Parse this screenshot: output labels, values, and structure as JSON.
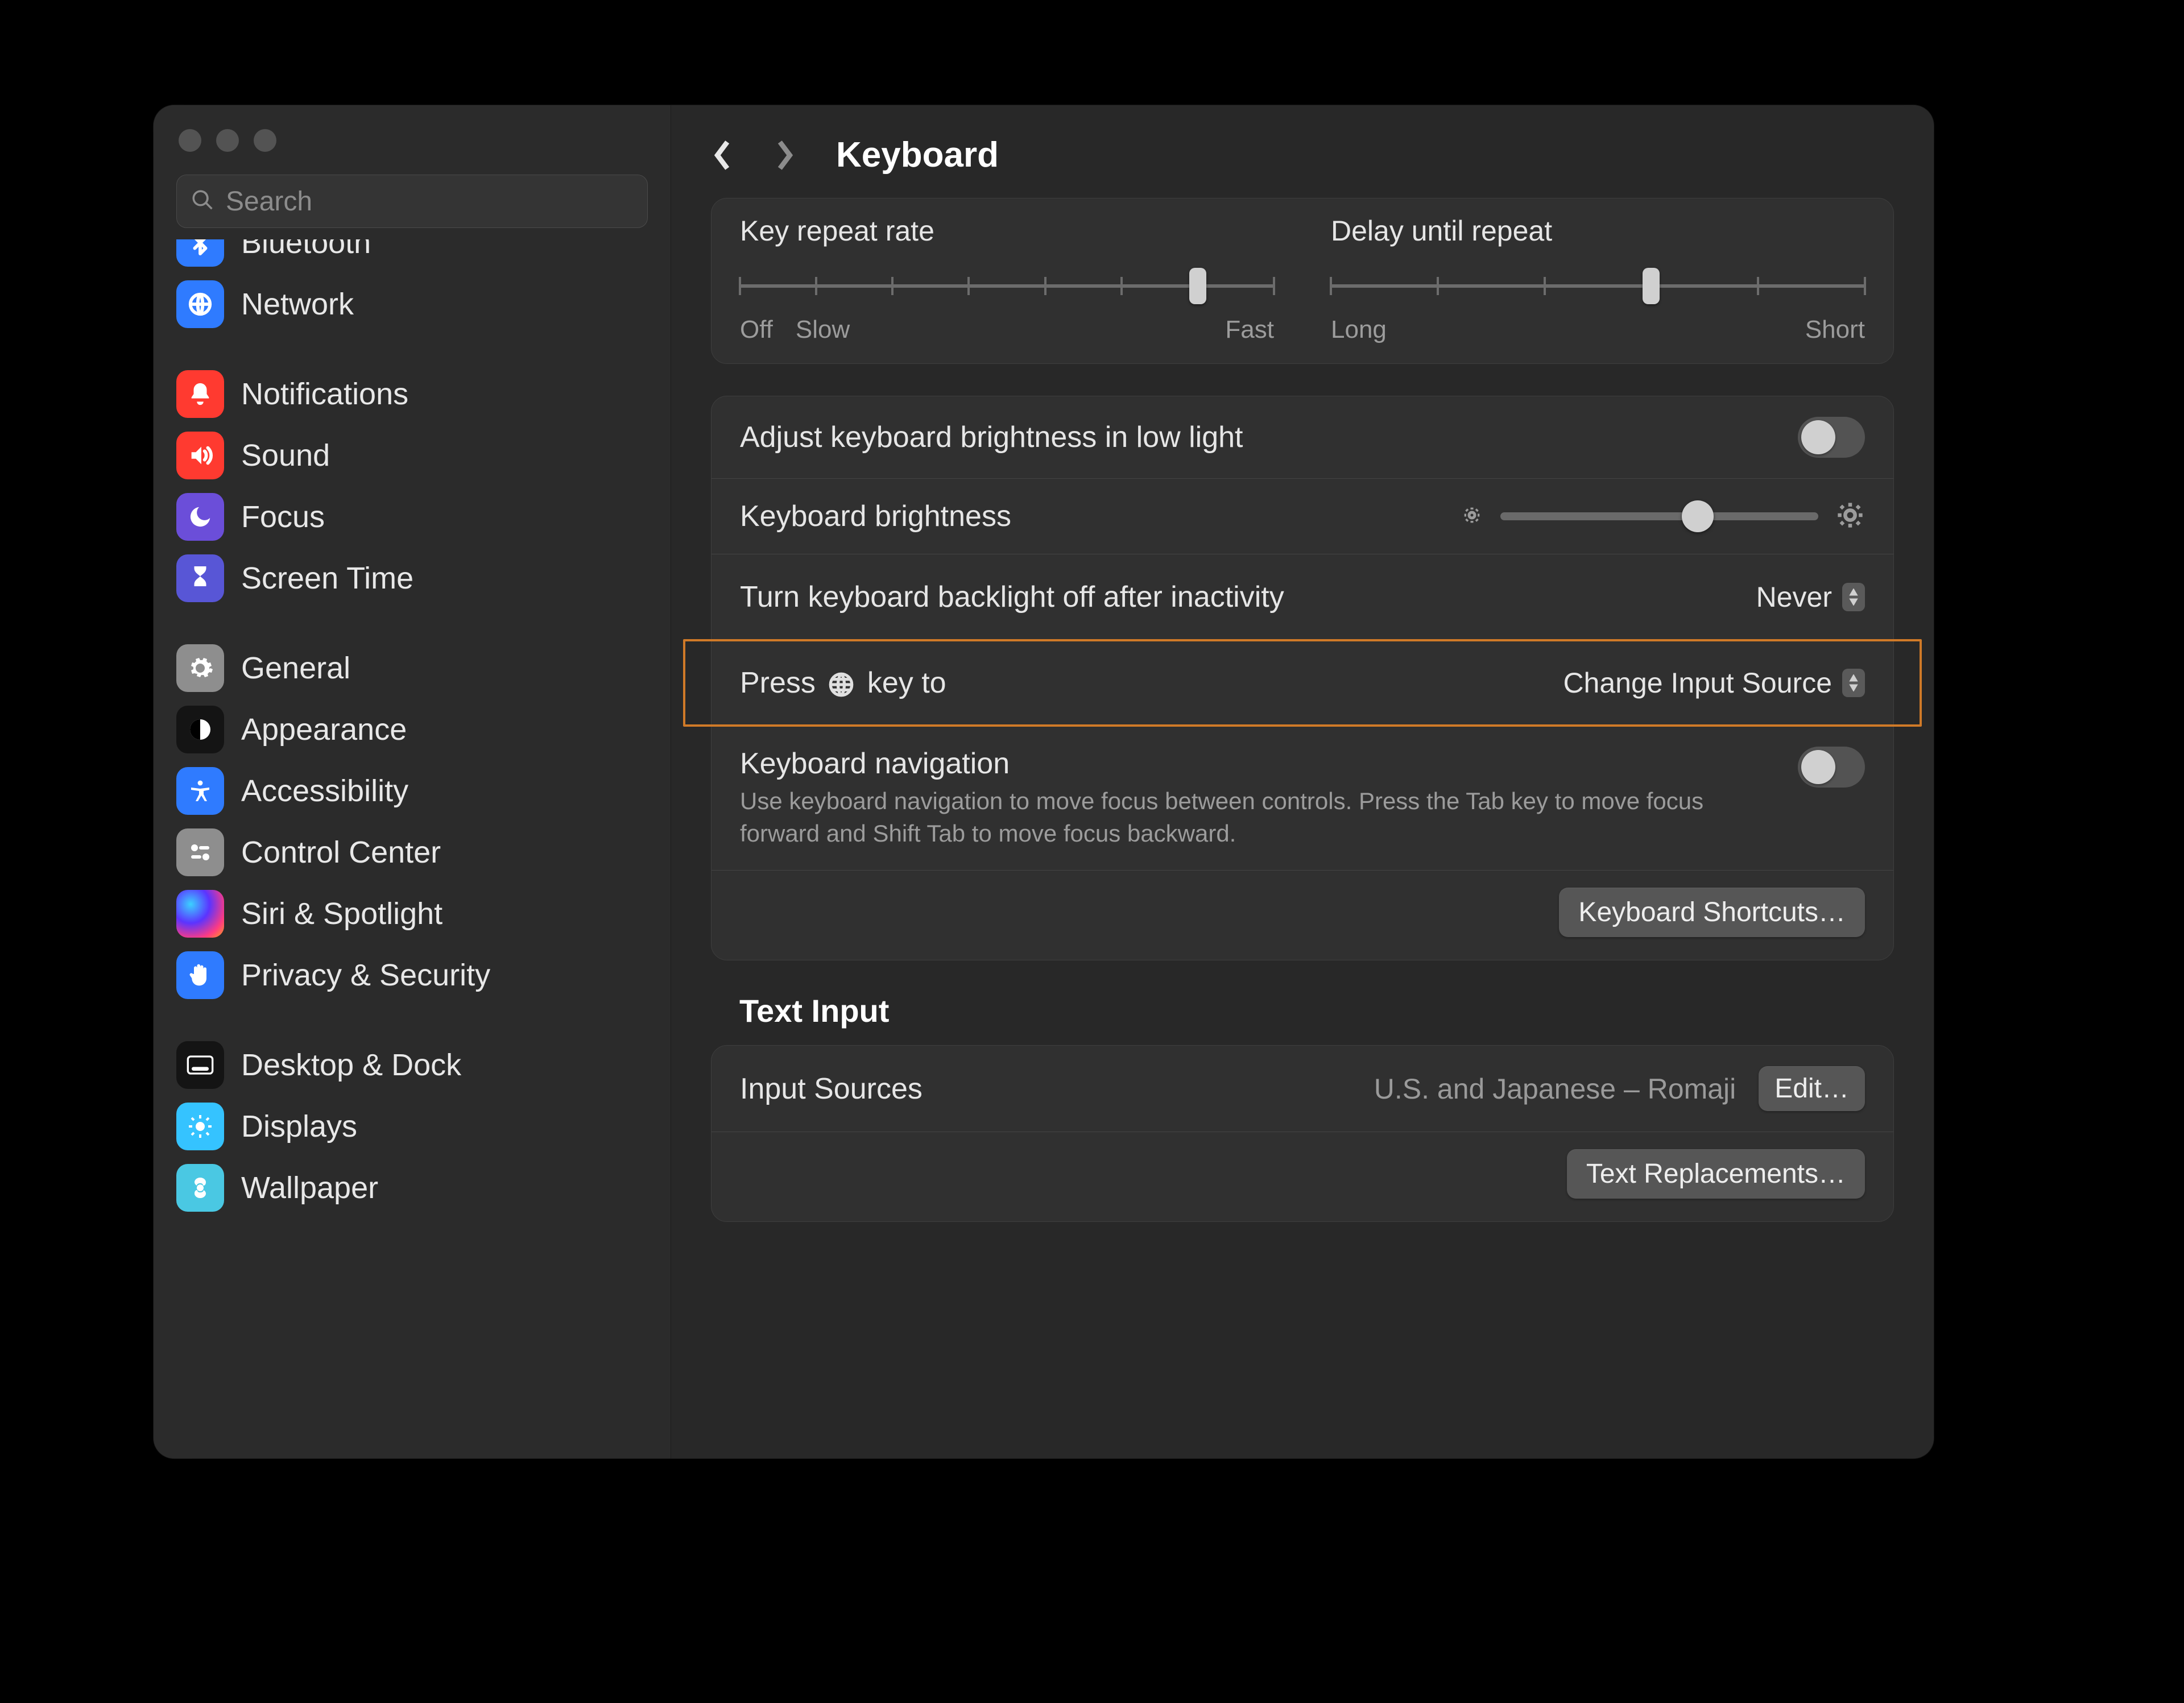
{
  "title": "Keyboard",
  "search": {
    "placeholder": "Search"
  },
  "sidebar": {
    "groups": [
      {
        "items": [
          {
            "label": "Bluetooth"
          },
          {
            "label": "Network"
          }
        ]
      },
      {
        "items": [
          {
            "label": "Notifications"
          },
          {
            "label": "Sound"
          },
          {
            "label": "Focus"
          },
          {
            "label": "Screen Time"
          }
        ]
      },
      {
        "items": [
          {
            "label": "General"
          },
          {
            "label": "Appearance"
          },
          {
            "label": "Accessibility"
          },
          {
            "label": "Control Center"
          },
          {
            "label": "Siri & Spotlight"
          },
          {
            "label": "Privacy & Security"
          }
        ]
      },
      {
        "items": [
          {
            "label": "Desktop & Dock"
          },
          {
            "label": "Displays"
          },
          {
            "label": "Wallpaper"
          }
        ]
      }
    ]
  },
  "repeat_panel": {
    "key_repeat": {
      "title": "Key repeat rate",
      "left_label": "Off",
      "left_label2": "Slow",
      "right_label": "Fast",
      "ticks": 8,
      "value_index": 6
    },
    "delay": {
      "title": "Delay until repeat",
      "left_label": "Long",
      "right_label": "Short",
      "ticks": 6,
      "value_index": 3
    }
  },
  "brightness_panel": {
    "auto_adjust": {
      "label": "Adjust keyboard brightness in low light",
      "on": false
    },
    "brightness": {
      "label": "Keyboard brightness",
      "value_pct": 62
    },
    "backlight_off": {
      "label": "Turn keyboard backlight off after inactivity",
      "value": "Never"
    },
    "globe_key": {
      "label_pre": "Press",
      "label_post": "key to",
      "value": "Change Input Source"
    },
    "nav": {
      "label": "Keyboard navigation",
      "desc": "Use keyboard navigation to move focus between controls. Press the Tab key to move focus forward and Shift Tab to move focus backward.",
      "on": false
    },
    "shortcuts_btn": "Keyboard Shortcuts…"
  },
  "text_input": {
    "heading": "Text Input",
    "input_sources": {
      "label": "Input Sources",
      "value": "U.S. and Japanese – Romaji",
      "edit": "Edit…"
    },
    "replacements_btn": "Text Replacements…"
  }
}
